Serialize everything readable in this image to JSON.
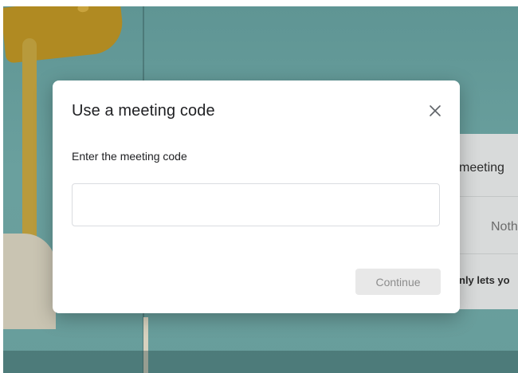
{
  "dialog": {
    "title": "Use a meeting code",
    "prompt": "Enter the meeting code",
    "input_value": "",
    "input_placeholder": "",
    "continue_label": "Continue",
    "close_icon": "close-icon"
  },
  "background_card": {
    "row1": "meeting",
    "row2": "Noth",
    "row3": "nly lets yo"
  },
  "colors": {
    "backdrop": "#659b99",
    "dialog_bg": "#ffffff",
    "continue_disabled_bg": "#e8e8e8",
    "continue_disabled_text": "#8c8c8c"
  }
}
